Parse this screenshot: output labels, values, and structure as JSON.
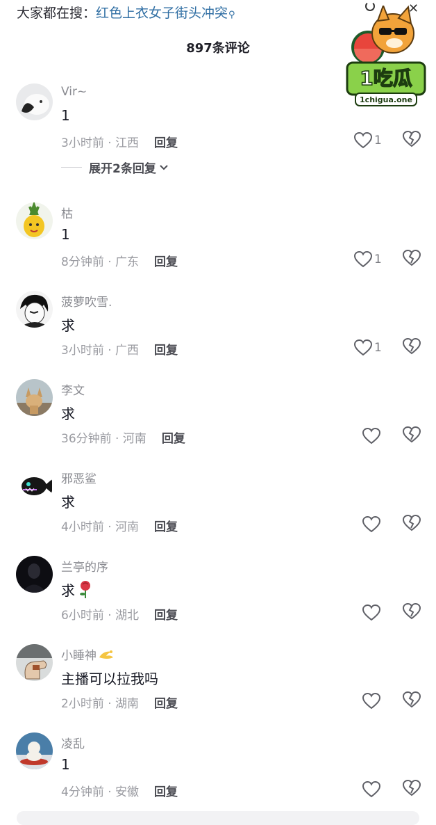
{
  "search": {
    "prefix": "大家都在搜：",
    "term": "红色上衣女子街头冲突"
  },
  "comment_count": "897条评论",
  "logo": {
    "big": "1吃瓜",
    "url": "1chigua.one"
  },
  "expand_label": "展开2条回复",
  "reply_label": "回复",
  "comments": [
    {
      "nick": "Vir~",
      "text": "1",
      "meta": "3小时前 · 江西",
      "likes": "1",
      "avatar": "white-cat"
    },
    {
      "nick": "枯",
      "text": "1",
      "meta": "8分钟前 · 广东",
      "likes": "1",
      "avatar": "pineapple"
    },
    {
      "nick": "菠萝吹雪.",
      "text": "求",
      "meta": "3小时前 · 广西",
      "likes": "1",
      "avatar": "anime-boy"
    },
    {
      "nick": "李文",
      "text": "求",
      "meta": "36分钟前 · 河南",
      "likes": "",
      "avatar": "fox"
    },
    {
      "nick": "邪恶鲨",
      "text": "求",
      "meta": "4小时前 · 河南",
      "likes": "",
      "avatar": "dark-fish"
    },
    {
      "nick": "兰亭的序",
      "text": "求",
      "meta": "6小时前 · 湖北",
      "likes": "",
      "avatar": "dark-person",
      "emoji": "rose"
    },
    {
      "nick": "小睡神",
      "text": "主播可以拉我吗",
      "meta": "2小时前 · 湖南",
      "likes": "",
      "avatar": "hand",
      "nick_emoji": "dizzy"
    },
    {
      "nick": "凌乱",
      "text": "1",
      "meta": "4分钟前 · 安徽",
      "likes": "",
      "avatar": "snow-figure"
    }
  ]
}
